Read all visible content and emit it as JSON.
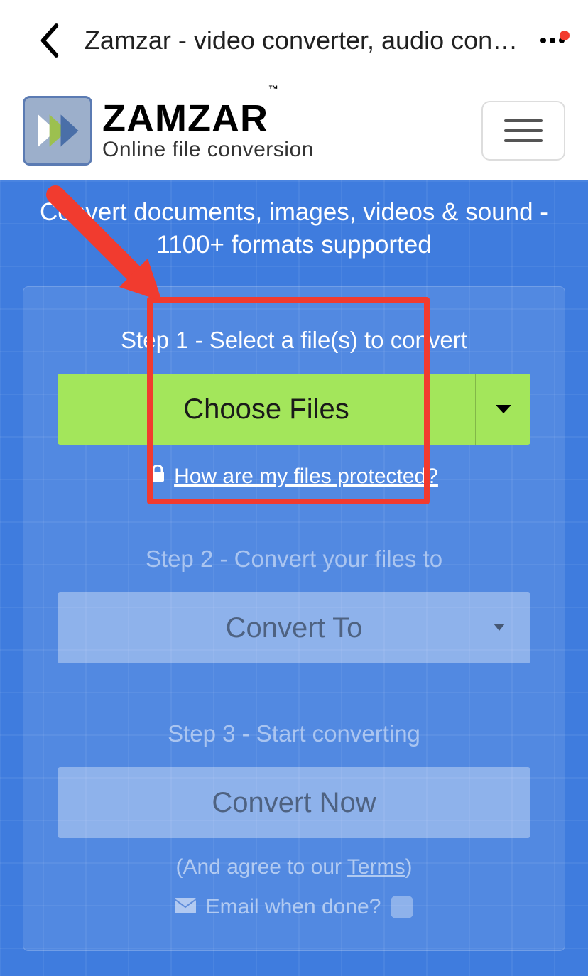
{
  "browser": {
    "title": "Zamzar - video converter, audio con…"
  },
  "logo": {
    "brand": "ZAMZAR",
    "tm": "™",
    "tagline": "Online file conversion"
  },
  "hero": "Convert documents, images, videos & sound - 1100+ formats supported",
  "step1": {
    "label": "Step 1 - Select a file(s) to convert",
    "choose": "Choose Files",
    "protect": "How are my files protected?"
  },
  "step2": {
    "label": "Step 2 - Convert your files to",
    "select": "Convert To"
  },
  "step3": {
    "label": "Step 3 - Start converting",
    "button": "Convert Now",
    "terms_pre": "(And agree to our ",
    "terms_link": "Terms",
    "terms_post": ")",
    "email_label": "Email when done?"
  },
  "colors": {
    "accent_green": "#a3e65b",
    "red": "#f13b2f",
    "blue": "#3f7cde"
  }
}
